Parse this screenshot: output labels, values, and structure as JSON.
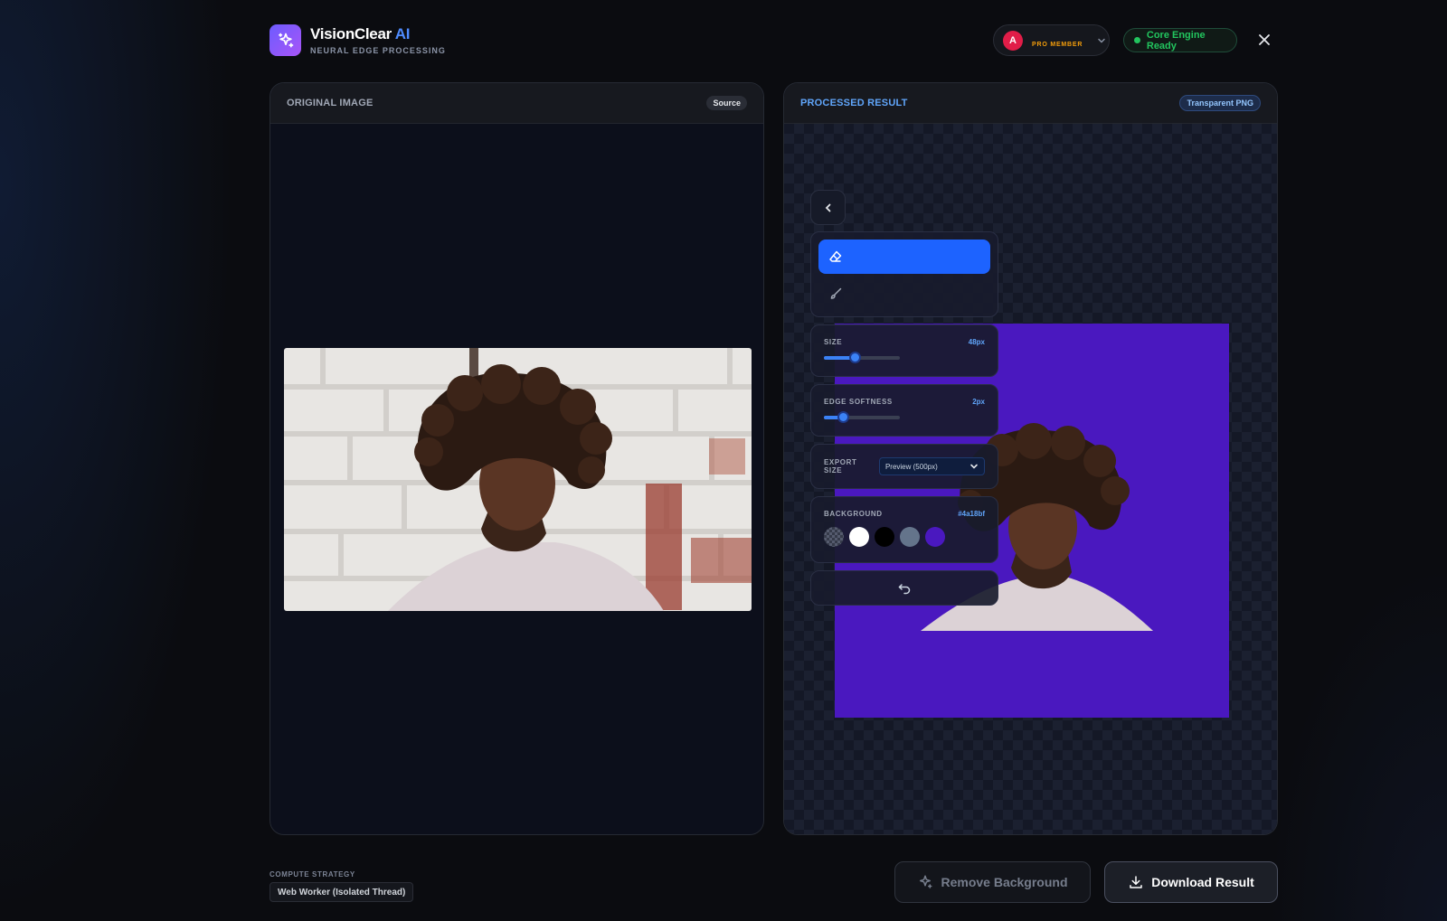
{
  "header": {
    "brand_name": "VisionClear",
    "brand_ai": "AI",
    "brand_subtitle": "NEURAL EDGE PROCESSING",
    "user_initial": "A",
    "member_label": "PRO MEMBER",
    "status_text": "Core Engine Ready",
    "icons": [
      "sparkles-icon",
      "chevron-down-icon",
      "close-icon"
    ]
  },
  "original_panel": {
    "title": "ORIGINAL IMAGE",
    "tag": "Source"
  },
  "result_panel": {
    "title": "PROCESSED RESULT",
    "tag": "Transparent PNG"
  },
  "tools": {
    "size_label": "SIZE",
    "size_value": "48px",
    "size_level": 0.4,
    "softness_label": "EDGE SOFTNESS",
    "softness_value": "2px",
    "softness_level": 0.25,
    "export_label": "EXPORT SIZE",
    "export_selected": "Preview (500px)",
    "background_label": "BACKGROUND",
    "background_value": "#4a18bf",
    "swatches": [
      "transparent",
      "#ffffff",
      "#000000",
      "#64748b",
      "#4a18bf"
    ],
    "icons": [
      "chevron-left-icon",
      "eraser-icon",
      "brush-icon",
      "undo-icon"
    ]
  },
  "footer": {
    "strategy_label": "COMPUTE STRATEGY",
    "strategy_value": "Web Worker (Isolated Thread)",
    "remove_label": "Remove Background",
    "download_label": "Download Result"
  },
  "colors": {
    "accent": "#1d63ff",
    "result_background": "#4a18bf",
    "status": "#22c55e",
    "member": "#f59e0b"
  }
}
